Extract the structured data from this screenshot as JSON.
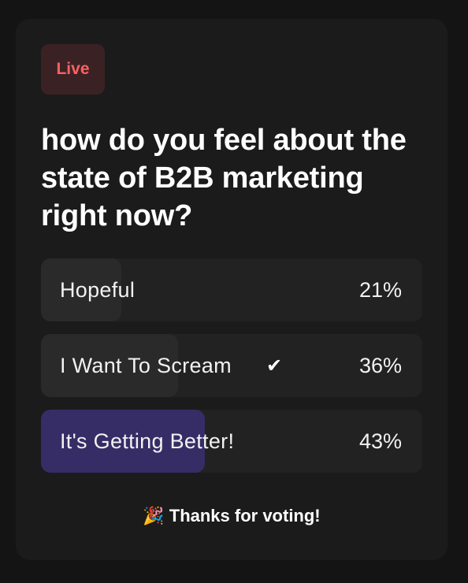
{
  "badge": {
    "label": "Live"
  },
  "poll": {
    "question": "how do you feel about the state of B2B marketing right now?",
    "options": [
      {
        "label": "Hopeful",
        "percent": "21%",
        "share": 0.21,
        "selected": false
      },
      {
        "label": "I Want To Scream",
        "percent": "36%",
        "share": 0.36,
        "selected": true
      },
      {
        "label": "It's Getting Better!",
        "percent": "43%",
        "share": 0.43,
        "selected": false
      }
    ]
  },
  "footer": {
    "thanks": "Thanks for voting!",
    "icon": "party-popper-icon"
  },
  "colors": {
    "live": "#ff5f5f",
    "leading_fill": "#362d66",
    "card": "#1b1b1b"
  }
}
